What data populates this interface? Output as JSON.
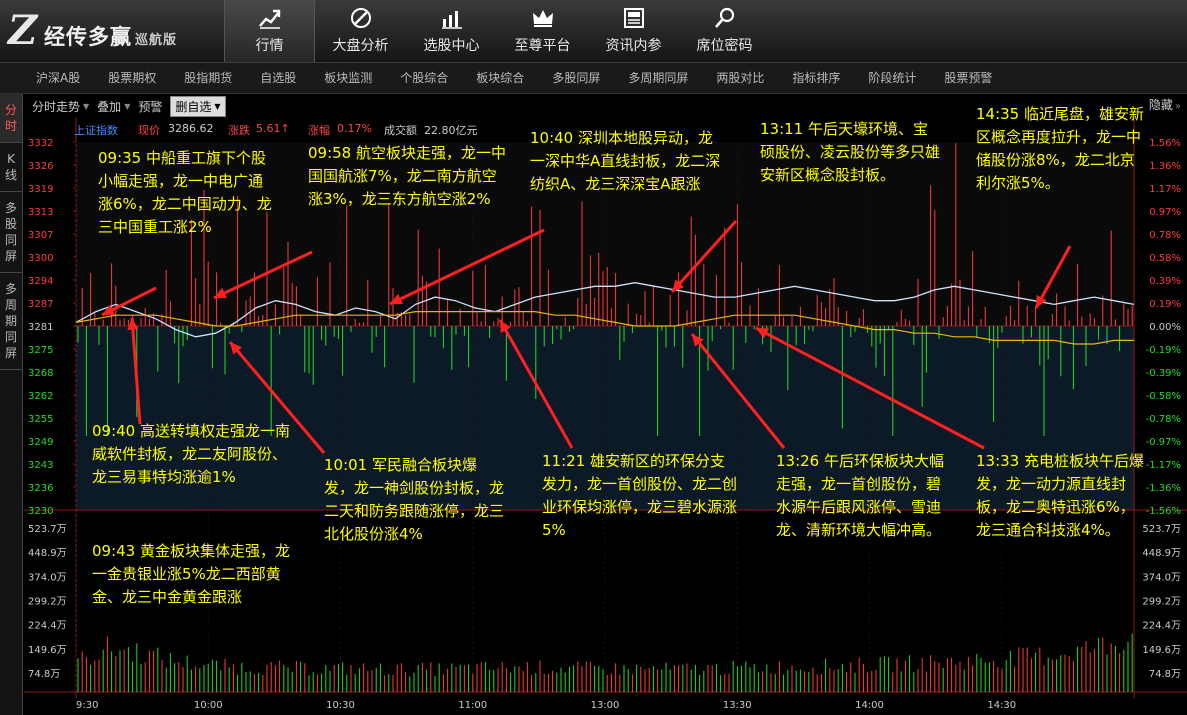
{
  "app": {
    "logo_mark": "Z",
    "name": "经传多赢",
    "version": "巡航版"
  },
  "topnav": [
    {
      "label": "行情",
      "icon": "chart-trend-icon",
      "active": true
    },
    {
      "label": "大盘分析",
      "icon": "compass-icon"
    },
    {
      "label": "选股中心",
      "icon": "bar-chart-icon"
    },
    {
      "label": "至尊平台",
      "icon": "crown-icon"
    },
    {
      "label": "资讯内参",
      "icon": "news-icon"
    },
    {
      "label": "席位密码",
      "icon": "magnifier-icon"
    }
  ],
  "subnav": [
    "沪深A股",
    "股票期权",
    "股指期货",
    "自选股",
    "板块监测",
    "个股综合",
    "板块综合",
    "多股同屏",
    "多周期同屏",
    "两股对比",
    "指标排序",
    "阶段统计",
    "股票预警"
  ],
  "lefttabs": [
    "分时",
    "K线",
    "多股同屏",
    "多周期同屏"
  ],
  "toolbar": {
    "items": [
      "分时走势",
      "叠加",
      "预警"
    ],
    "select": "删自选",
    "hide": "隐藏"
  },
  "header": {
    "index": "上证指数",
    "price_label": "现价",
    "price": "3286.62",
    "change_label": "涨跌",
    "change": "5.61↑",
    "pct_label": "涨幅",
    "pct": "0.17%",
    "volume_label": "成交额",
    "volume": "22.80亿元"
  },
  "colors": {
    "up": "#ff3c3c",
    "down": "#22dd22",
    "annotation": "#ffff00",
    "arrow": "#ff2020",
    "white_line": "#cfe0ff",
    "avg_line": "#e8b800",
    "axis": "#8b1a1a"
  },
  "chart_data": {
    "type": "line",
    "price_axis": [
      "3332",
      "3326",
      "3319",
      "3313",
      "3307",
      "3300",
      "3294",
      "3287",
      "3281",
      "3275",
      "3268",
      "3262",
      "3255",
      "3249",
      "3243",
      "3236",
      "3230"
    ],
    "pct_axis": [
      "1.56%",
      "1.36%",
      "1.17%",
      "0.97%",
      "0.78%",
      "0.58%",
      "0.39%",
      "0.19%",
      "0.00%",
      "-0.19%",
      "-0.39%",
      "-0.58%",
      "-0.78%",
      "-0.97%",
      "-1.17%",
      "-1.36%",
      "-1.56%"
    ],
    "vol_axis": [
      "523.7万",
      "448.9万",
      "374.0万",
      "299.2万",
      "224.4万",
      "149.6万",
      "74.8万"
    ],
    "time_axis": [
      "9:30",
      "10:00",
      "10:30",
      "11:00",
      "13:00",
      "13:30",
      "14:00",
      "14:30"
    ],
    "ylim": [
      3230,
      3332
    ],
    "ref_price": 3281,
    "price": [
      3282,
      3285,
      3287,
      3285,
      3283,
      3280,
      3278,
      3279,
      3282,
      3286,
      3288,
      3287,
      3285,
      3284,
      3286,
      3285,
      3283,
      3287,
      3289,
      3288,
      3286,
      3285,
      3287,
      3289,
      3290,
      3291,
      3292,
      3292,
      3293,
      3292,
      3291,
      3290,
      3289,
      3289,
      3290,
      3291,
      3292,
      3291,
      3290,
      3289,
      3288,
      3288,
      3289,
      3291,
      3292,
      3291,
      3290,
      3289,
      3288,
      3287,
      3288,
      3289,
      3288,
      3287
    ],
    "average": [
      3282,
      3283,
      3284,
      3284,
      3284,
      3283,
      3282,
      3281,
      3281,
      3282,
      3283,
      3284,
      3284,
      3284,
      3284,
      3284,
      3284,
      3285,
      3285,
      3285,
      3285,
      3285,
      3285,
      3285,
      3284,
      3284,
      3283,
      3282,
      3281,
      3281,
      3281,
      3282,
      3283,
      3284,
      3284,
      3284,
      3284,
      3283,
      3282,
      3281,
      3280,
      3280,
      3279,
      3279,
      3278,
      3278,
      3277,
      3277,
      3277,
      3277,
      3276,
      3276,
      3277,
      3277
    ],
    "volume_ylim": [
      0,
      560
    ],
    "volume_trend": [
      110,
      160,
      150,
      120,
      105,
      95,
      92,
      90,
      88,
      88,
      86,
      85,
      86,
      88,
      90,
      92,
      90,
      88,
      87,
      86,
      86,
      88,
      90,
      92,
      95,
      97,
      100,
      104,
      108,
      112,
      118,
      126,
      135,
      150,
      170,
      210
    ]
  },
  "annotations": [
    {
      "text": "09:35 中船重工旗下个股小幅走强，龙一中电广通涨6%，龙二中国动力、龙三中国重工涨2%"
    },
    {
      "text": "09:58 航空板块走强，龙一中国国航涨7%，龙二南方航空涨3%，龙三东方航空涨2%"
    },
    {
      "text": "10:40 深圳本地股异动，龙一深中华A直线封板，龙二深纺织A、龙三深深宝A跟涨"
    },
    {
      "text": "13:11 午后天壕环境、宝硕股份、凌云股份等多只雄安新区概念股封板。"
    },
    {
      "text": "14:35 临近尾盘，雄安新区概念再度拉升，龙一中储股份涨8%，龙二北京利尔涨5%。"
    },
    {
      "text": "09:40 高送转填权走强龙一南威软件封板，龙二友阿股份、龙三易事特均涨逾1%"
    },
    {
      "text": "10:01 军民融合板块爆发，龙一神剑股份封板，龙二天和防务跟随涨停，龙三北化股份涨4%"
    },
    {
      "text": "11:21 雄安新区的环保分支发力，龙一首创股份、龙二创业环保均涨停，龙三碧水源涨5%"
    },
    {
      "text": "13:26 午后环保板块大幅走强，龙一首创股份，碧水源午后跟风涨停、雪迪龙、清新环境大幅冲高。"
    },
    {
      "text": "13:33 充电桩板块午后爆发，龙一动力源直线封板，龙二奥特迅涨6%，龙三通合科技涨4%。"
    },
    {
      "text": "09:43 黄金板块集体走强，龙一金贵银业涨5%龙二西部黄金、龙三中金黄金跟涨"
    }
  ]
}
